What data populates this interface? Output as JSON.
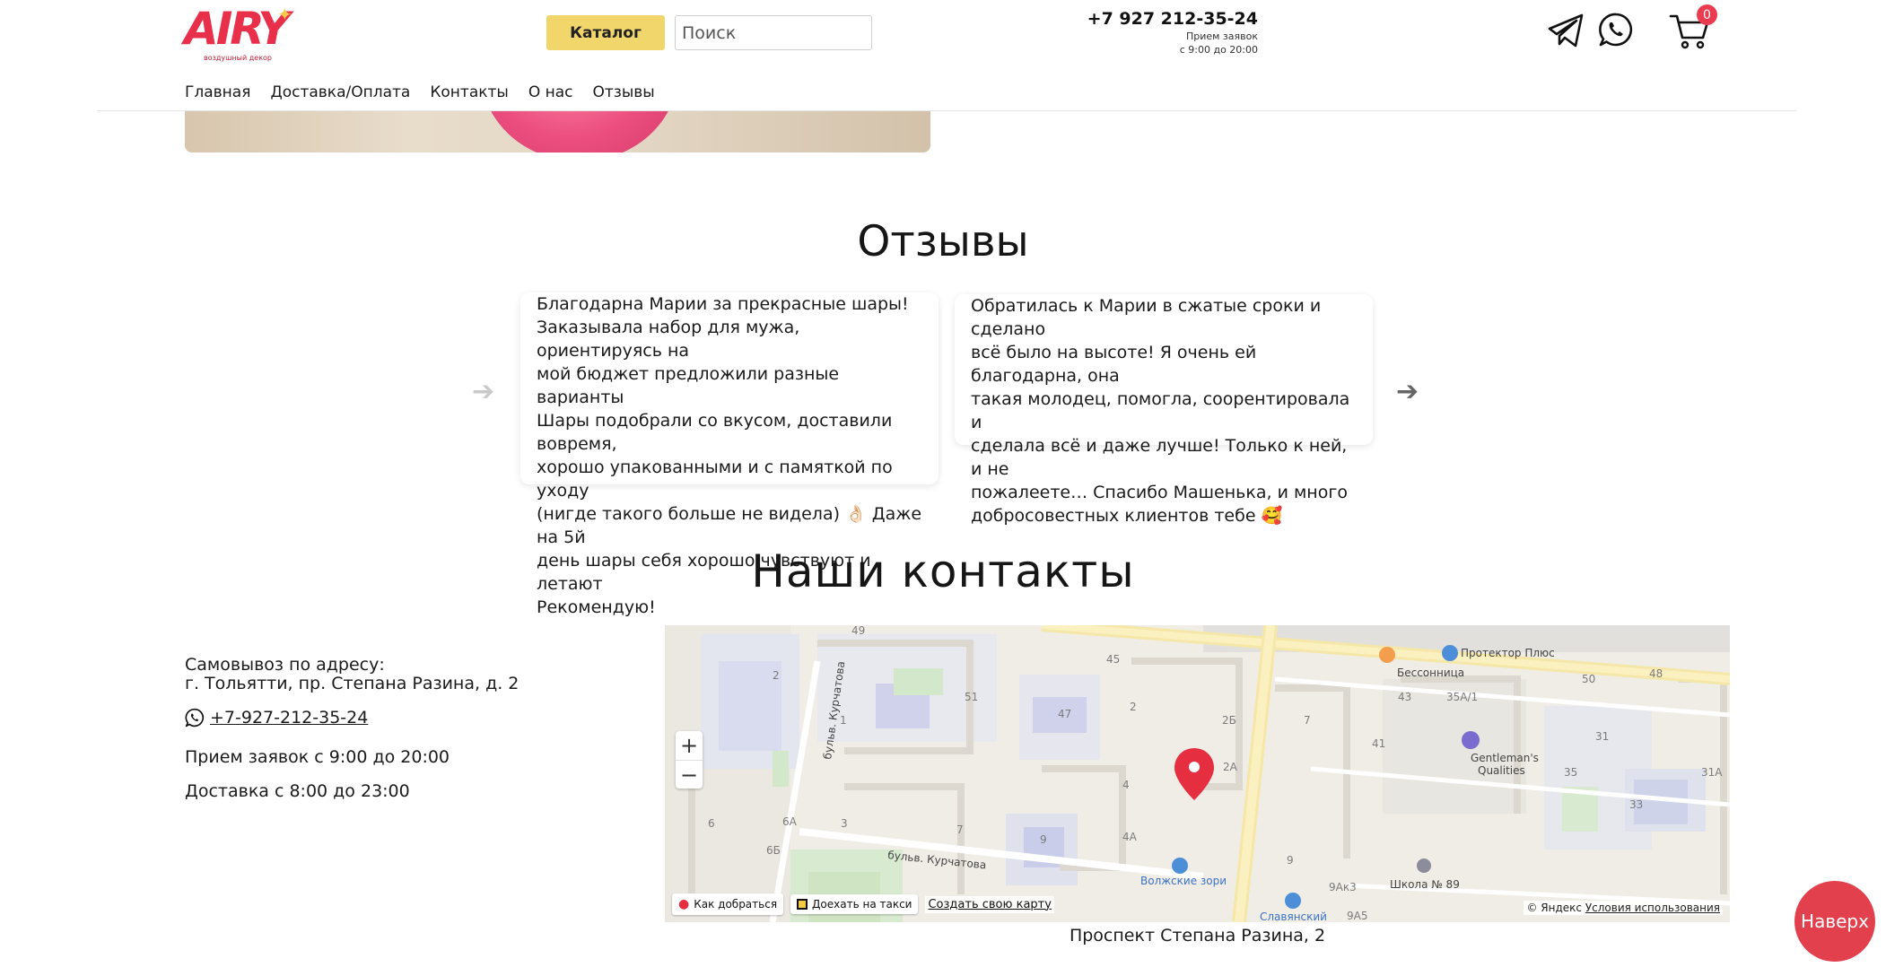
{
  "header": {
    "logo_text": "AIRY",
    "logo_subtitle": "воздушный декор",
    "catalog_label": "Каталог",
    "search_placeholder": "Поиск",
    "phone": "+7 927 212-35-24",
    "hours_line1": "Прием заявок",
    "hours_line2": "с 9:00 до 20:00",
    "cart_count": "0",
    "icons": [
      "telegram-icon",
      "whatsapp-icon",
      "cart-icon"
    ]
  },
  "nav": {
    "items": [
      {
        "label": "Главная"
      },
      {
        "label": "Доставка/Оплата"
      },
      {
        "label": "Контакты"
      },
      {
        "label": "О нас"
      },
      {
        "label": "Отзывы"
      }
    ]
  },
  "reviews": {
    "title": "Отзывы",
    "items": [
      {
        "lines": [
          "Благодарна Марии за прекрасные шары!",
          "Заказывала набор для мужа, ориентируясь на",
          "мой бюджет предложили разные варианты",
          "Шары подобрали со вкусом, доставили вовремя,",
          "хорошо упакованными и с памяткой по уходу",
          "(нигде такого больше не видела) 👌🏻 Даже на 5й",
          "день шары себя хорошо чувствуют и летают",
          "Рекомендую!"
        ]
      },
      {
        "lines": [
          "Обратилась к Марии в сжатые сроки и сделано",
          "всё было на высоте! Я очень ей благодарна, она",
          "такая молодец, помогла, соорентировала и",
          "сделала всё и даже лучше! Только к ней, и не",
          "пожалеете… Спасибо Машенька, и много",
          "добросовестных клиентов тебе 🥰"
        ]
      }
    ]
  },
  "contacts": {
    "title": "Наши контакты",
    "pickup_line1": "Самовывоз по адресу:",
    "pickup_line2": "г. Тольятти, пр. Степана Разина, д. 2",
    "phone": "+7-927-212-35-24",
    "hours": "Прием заявок с 9:00 до 20:00",
    "delivery": "Доставка с 8:00 до 23:00"
  },
  "map": {
    "zoom_in": "+",
    "zoom_out": "−",
    "route_label": "Как добраться",
    "taxi_label": "Доехать на такси",
    "create_label": "Создать свою карту",
    "copyright": "© Яндекс",
    "terms": "Условия использования",
    "caption": "Проспект Степана Разина, 2",
    "labels": {
      "besson": "Бессонница",
      "protector": "Протектор Плюс",
      "gentlemans1": "Gentleman's",
      "gentlemans2": "Qualities",
      "kurchatova_v": "бульв. Курчатова",
      "kurchatova_h": "бульв. Курчатова",
      "volzhskie": "Волжские зори",
      "school": "Школа № 89",
      "slav": "Славянский"
    },
    "house_numbers": [
      "45",
      "49",
      "51",
      "47",
      "2",
      "2Б",
      "7",
      "43",
      "35А/1",
      "50",
      "48",
      "31",
      "41",
      "4",
      "2А",
      "35",
      "31А",
      "33",
      "4А",
      "6А",
      "3",
      "7",
      "6Б",
      "6",
      "9",
      "9",
      "9Ак3",
      "9А5",
      "1",
      "2"
    ]
  },
  "to_top_label": "Наверх"
}
